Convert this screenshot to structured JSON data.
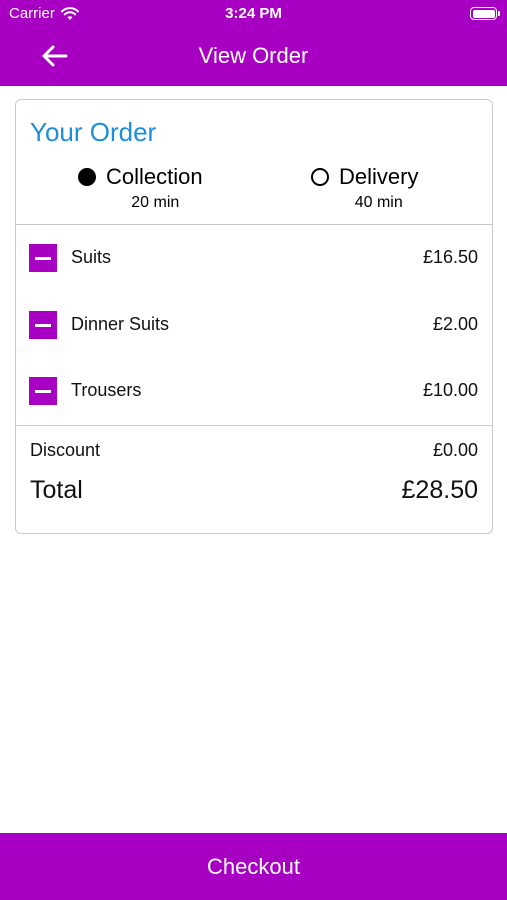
{
  "status_bar": {
    "carrier": "Carrier",
    "time": "3:24 PM"
  },
  "nav": {
    "title": "View Order",
    "back_icon": "arrow-left-icon"
  },
  "order": {
    "title": "Your Order",
    "options": [
      {
        "label": "Collection",
        "time": "20 min",
        "selected": true
      },
      {
        "label": "Delivery",
        "time": "40 min",
        "selected": false
      }
    ],
    "items": [
      {
        "name": "Suits",
        "price": "£16.50"
      },
      {
        "name": "Dinner Suits",
        "price": "£2.00"
      },
      {
        "name": "Trousers",
        "price": "£10.00"
      }
    ],
    "discount_label": "Discount",
    "discount_value": "£0.00",
    "total_label": "Total",
    "total_value": "£28.50"
  },
  "footer": {
    "checkout_label": "Checkout"
  },
  "colors": {
    "brand": "#A800C2",
    "title_blue": "#1B8FD8"
  }
}
